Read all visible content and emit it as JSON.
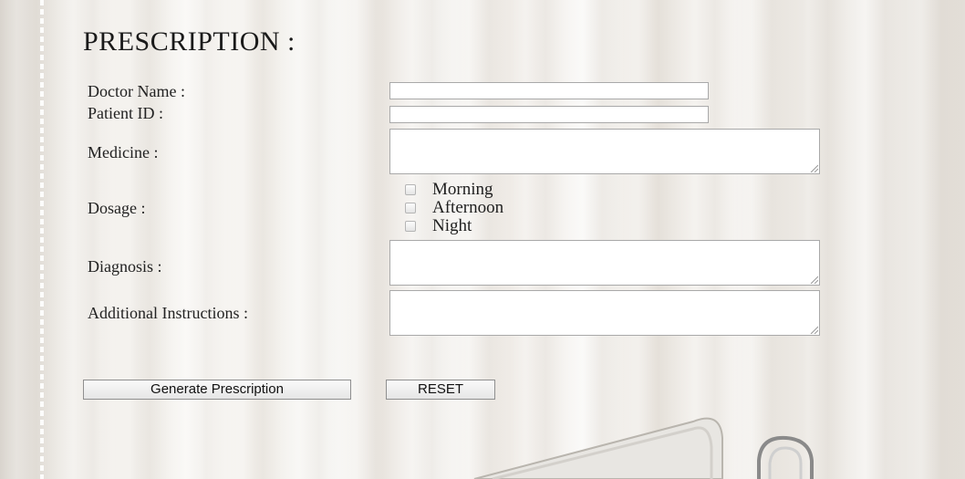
{
  "form": {
    "title": "PRESCRIPTION :",
    "doctor_name": {
      "label": "Doctor Name :",
      "value": ""
    },
    "patient_id": {
      "label": "Patient ID :",
      "value": ""
    },
    "medicine": {
      "label": "Medicine :",
      "value": ""
    },
    "dosage": {
      "label": "Dosage :",
      "options": [
        {
          "label": "Morning",
          "checked": false
        },
        {
          "label": "Afternoon",
          "checked": false
        },
        {
          "label": "Night",
          "checked": false
        }
      ]
    },
    "diagnosis": {
      "label": "Diagnosis :",
      "value": ""
    },
    "additional_instructions": {
      "label": "Additional Instructions :",
      "value": ""
    }
  },
  "buttons": {
    "generate_label": "Generate Prescription",
    "reset_label": "RESET"
  },
  "icons": {
    "resize_grip": "resize-grip-icon",
    "checkbox": "checkbox-icon"
  },
  "colors": {
    "background": "#f3f0ec",
    "input_border": "#a9a9a9",
    "text": "#222222"
  }
}
